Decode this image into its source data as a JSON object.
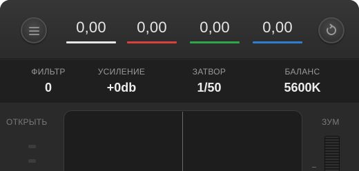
{
  "topbar": {
    "menu_icon": "hamburger-menu-icon",
    "reset_icon": "reset-arrow-icon",
    "gains": [
      {
        "value": "0,00",
        "color": "#e8e8e8"
      },
      {
        "value": "0,00",
        "color": "#d9413a"
      },
      {
        "value": "0,00",
        "color": "#2fa84a"
      },
      {
        "value": "0,00",
        "color": "#2f7fd0"
      }
    ]
  },
  "settings": {
    "filter": {
      "label": "ФИЛЬТР",
      "value": "0"
    },
    "gain": {
      "label": "УСИЛЕНИЕ",
      "value": "+0db"
    },
    "shutter": {
      "label": "ЗАТВОР",
      "value": "1/50"
    },
    "balance": {
      "label": "БАЛАНС",
      "value": "5600K"
    }
  },
  "lower": {
    "iris_label": "ОТКРЫТЬ",
    "zoom_label": "ЗУМ"
  }
}
